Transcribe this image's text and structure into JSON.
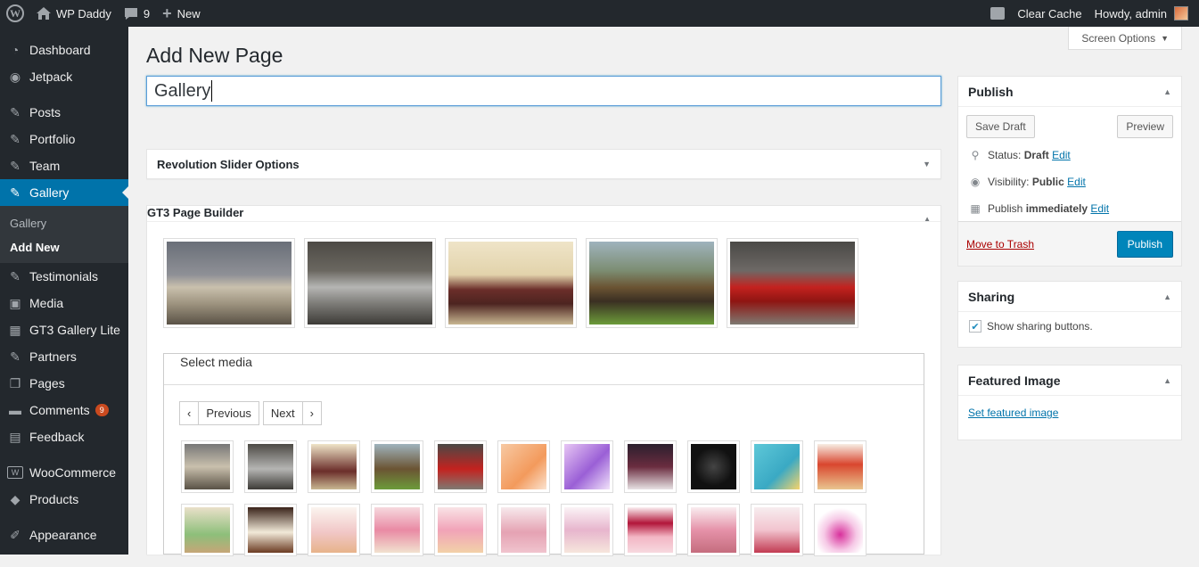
{
  "adminbar": {
    "site_name": "WP Daddy",
    "comments_count": "9",
    "new_label": "New",
    "clear_cache": "Clear Cache",
    "howdy": "Howdy, admin"
  },
  "sidebar": {
    "items": [
      {
        "label": "Dashboard",
        "icon": "dashboard-icon"
      },
      {
        "label": "Jetpack",
        "icon": "jetpack-icon"
      },
      {
        "label": "Posts",
        "icon": "pin-icon"
      },
      {
        "label": "Portfolio",
        "icon": "pin-icon"
      },
      {
        "label": "Team",
        "icon": "pin-icon"
      },
      {
        "label": "Gallery",
        "icon": "pin-icon"
      },
      {
        "label": "Testimonials",
        "icon": "pin-icon"
      },
      {
        "label": "Media",
        "icon": "media-icon"
      },
      {
        "label": "GT3 Gallery Lite",
        "icon": "gallery-icon"
      },
      {
        "label": "Partners",
        "icon": "pin-icon"
      },
      {
        "label": "Pages",
        "icon": "pages-icon"
      },
      {
        "label": "Comments",
        "icon": "comments-icon",
        "badge": "9"
      },
      {
        "label": "Feedback",
        "icon": "feedback-icon"
      },
      {
        "label": "WooCommerce",
        "icon": "woocommerce-icon"
      },
      {
        "label": "Products",
        "icon": "products-icon"
      },
      {
        "label": "Appearance",
        "icon": "appearance-icon"
      }
    ],
    "submenu": [
      "Gallery",
      "Add New"
    ]
  },
  "main": {
    "screen_options": "Screen Options",
    "page_title": "Add New Page",
    "title_value": "Gallery",
    "revslider_title": "Revolution Slider Options",
    "gt3_title": "GT3 Page Builder",
    "select_media": "Select media",
    "prev_label": "Previous",
    "next_label": "Next"
  },
  "publish": {
    "title": "Publish",
    "save_draft": "Save Draft",
    "preview": "Preview",
    "status_label": "Status:",
    "status_value": "Draft",
    "visibility_label": "Visibility:",
    "visibility_value": "Public",
    "publish_label": "Publish",
    "publish_value": "immediately",
    "edit": "Edit",
    "trash": "Move to Trash",
    "publish_button": "Publish"
  },
  "sharing": {
    "title": "Sharing",
    "checkbox_label": "Show sharing buttons.",
    "checked": true
  },
  "featured": {
    "title": "Featured Image",
    "link": "Set featured image"
  },
  "colors": {
    "accent": "#0073aa",
    "adminbar": "#23282d",
    "publish_button": "#0085ba"
  }
}
